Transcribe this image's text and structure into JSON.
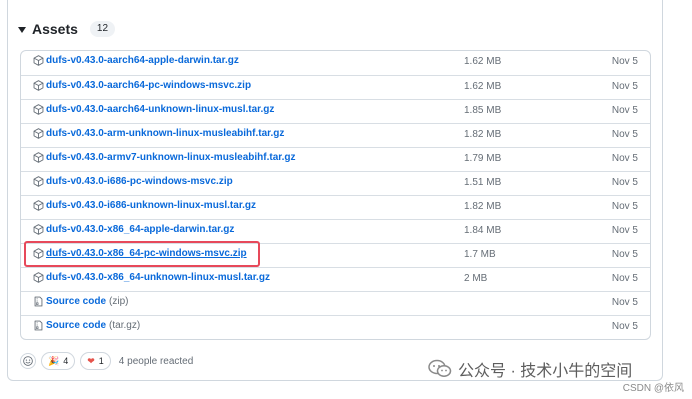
{
  "assets": {
    "title": "Assets",
    "count": "12",
    "items": [
      {
        "name": "dufs-v0.43.0-aarch64-apple-darwin.tar.gz",
        "size": "1.62 MB",
        "date": "Nov 5"
      },
      {
        "name": "dufs-v0.43.0-aarch64-pc-windows-msvc.zip",
        "size": "1.62 MB",
        "date": "Nov 5"
      },
      {
        "name": "dufs-v0.43.0-aarch64-unknown-linux-musl.tar.gz",
        "size": "1.85 MB",
        "date": "Nov 5"
      },
      {
        "name": "dufs-v0.43.0-arm-unknown-linux-musleabihf.tar.gz",
        "size": "1.82 MB",
        "date": "Nov 5"
      },
      {
        "name": "dufs-v0.43.0-armv7-unknown-linux-musleabihf.tar.gz",
        "size": "1.79 MB",
        "date": "Nov 5"
      },
      {
        "name": "dufs-v0.43.0-i686-pc-windows-msvc.zip",
        "size": "1.51 MB",
        "date": "Nov 5"
      },
      {
        "name": "dufs-v0.43.0-i686-unknown-linux-musl.tar.gz",
        "size": "1.82 MB",
        "date": "Nov 5"
      },
      {
        "name": "dufs-v0.43.0-x86_64-apple-darwin.tar.gz",
        "size": "1.84 MB",
        "date": "Nov 5"
      },
      {
        "name": "dufs-v0.43.0-x86_64-pc-windows-msvc.zip",
        "size": "1.7 MB",
        "date": "Nov 5"
      },
      {
        "name": "dufs-v0.43.0-x86_64-unknown-linux-musl.tar.gz",
        "size": "2 MB",
        "date": "Nov 5"
      }
    ],
    "source_code": [
      {
        "name": "Source code",
        "suffix": "(zip)",
        "date": "Nov 5"
      },
      {
        "name": "Source code",
        "suffix": "(tar.gz)",
        "date": "Nov 5"
      }
    ]
  },
  "reactions": {
    "party_emoji": "🎉",
    "party_count": "4",
    "heart_emoji": "❤",
    "heart_count": "1",
    "summary": "4 people reacted"
  },
  "watermark": {
    "text": "公众号 · 技术小牛的空间",
    "csdn": "CSDN @依风"
  },
  "colors": {
    "link": "#0969da",
    "highlight": "#e7495a",
    "muted": "#656d76"
  }
}
